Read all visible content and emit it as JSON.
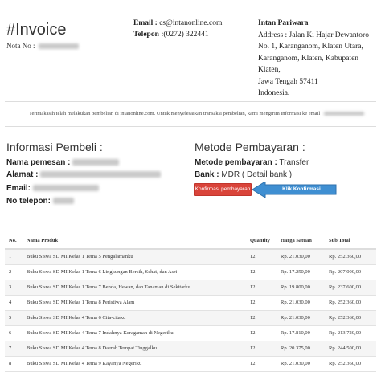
{
  "header": {
    "title": "#Invoice",
    "nota_label": "Nota No :",
    "email_label": "Email :",
    "email_value": "cs@intanonline.com",
    "telepon_label": "Telepon :",
    "telepon_value": "(0272) 322441",
    "company_name": "Intan Pariwara",
    "address_lines": [
      "Address : Jalan Ki Hajar Dewantoro",
      "No. 1, Karanganom, Klaten Utara,",
      "Karanganom, Klaten, Kabupaten Klaten,",
      "Jawa Tengah 57411",
      "Indonesia."
    ]
  },
  "thanks_text": "Terimakasih telah melakukan pembelian di intanonline.com. Untuk menyelesaikan transaksi pembelian, kami mengirim informasi ke email",
  "buyer": {
    "title": "Informasi Pembeli :",
    "name_label": "Nama pemesan :",
    "address_label": "Alamat :",
    "email_label": "Email:",
    "phone_label": "No telepon:"
  },
  "payment": {
    "title": "Metode Pembayaran :",
    "method_label": "Metode pembayaran :",
    "method_value": "Transfer",
    "bank_label": "Bank :",
    "bank_value": "MDR ( Detail bank )",
    "confirm_button": "Konfirmasi pembayaran",
    "arrow_callout": "Klik Konfirmasi Pembayaran"
  },
  "colors": {
    "confirm_button": "#d9443a",
    "arrow_callout": "#3f8fd2"
  },
  "table": {
    "headers": [
      "No.",
      "Nama Produk",
      "Quantity",
      "Harga Satuan",
      "Sub Total"
    ],
    "rows": [
      [
        "1",
        "Buku Siswa SD MI Kelas 1 Tema 5 Pengalamanku",
        "12",
        "Rp. 21.030,00",
        "Rp. 252.360,00"
      ],
      [
        "2",
        "Buku Siswa SD MI Kelas 1 Tema 6 Lingkungan Bersih, Sehat, dan Asri",
        "12",
        "Rp. 17.250,00",
        "Rp. 207.000,00"
      ],
      [
        "3",
        "Buku Siswa SD MI Kelas 1 Tema 7 Benda, Hewan, dan Tanaman di Sekitarku",
        "12",
        "Rp. 19.800,00",
        "Rp. 237.600,00"
      ],
      [
        "4",
        "Buku Siswa SD MI Kelas 1 Tema 8 Peristiwa Alam",
        "12",
        "Rp. 21.030,00",
        "Rp. 252.360,00"
      ],
      [
        "5",
        "Buku Siswa SD MI Kelas 4 Tema 6 Cita-citaku",
        "12",
        "Rp. 21.030,00",
        "Rp. 252.360,00"
      ],
      [
        "6",
        "Buku Siswa SD MI Kelas 4 Tema 7 Indahnya Keragaman di Negeriku",
        "12",
        "Rp. 17.810,00",
        "Rp. 213.720,00"
      ],
      [
        "7",
        "Buku Siswa SD MI Kelas 4 Tema 8 Daerah Tempat Tinggalku",
        "12",
        "Rp. 20.375,00",
        "Rp. 244.500,00"
      ],
      [
        "8",
        "Buku Siswa SD MI Kelas 4 Tema 9 Kayanya Negeriku",
        "12",
        "Rp. 21.030,00",
        "Rp. 252.360,00"
      ]
    ]
  }
}
